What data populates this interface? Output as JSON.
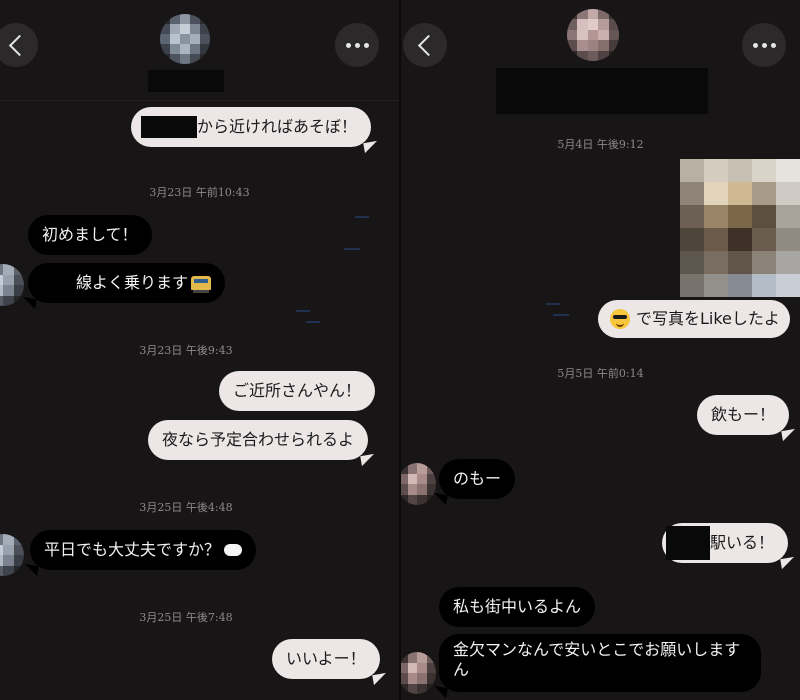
{
  "colors": {
    "background": "#171515",
    "incoming_bubble": "#000000",
    "outgoing_bubble": "#ece6e6",
    "timestamp": "#8d8a8a",
    "button": "#2b2929"
  },
  "left_chat": {
    "header": {
      "back_icon": "chevron-left-icon",
      "more_icon": "more-dots-icon",
      "contact_name": ""
    },
    "messages": [
      {
        "type": "out",
        "text": "から近ければあそぼ！"
      },
      {
        "type": "time",
        "text": "3月23日 午前10:43"
      },
      {
        "type": "in",
        "text": "初めまして！"
      },
      {
        "type": "in",
        "text": "線よく乗ります",
        "icon": "tram-icon"
      },
      {
        "type": "time",
        "text": "3月23日 午後9:43"
      },
      {
        "type": "out",
        "text": "ご近所さんやん！"
      },
      {
        "type": "out",
        "text": "夜なら予定合わせられるよ"
      },
      {
        "type": "time",
        "text": "3月25日 午後4:48"
      },
      {
        "type": "in",
        "text": "平日でも大丈夫ですか？",
        "icon": "thought-balloon-icon"
      },
      {
        "type": "time",
        "text": "3月25日 午後7:48"
      },
      {
        "type": "out",
        "text": "いいよー！"
      }
    ]
  },
  "right_chat": {
    "header": {
      "back_icon": "chevron-left-icon",
      "more_icon": "more-dots-icon",
      "contact_name": ""
    },
    "messages": [
      {
        "type": "time",
        "text": "5月4日 午後9:12"
      },
      {
        "type": "photo",
        "text": ""
      },
      {
        "type": "out",
        "text": "で写真をLikeしたよ",
        "icon": "sunglasses-face-icon"
      },
      {
        "type": "time",
        "text": "5月5日 午前0:14"
      },
      {
        "type": "out",
        "text": "飲もー！"
      },
      {
        "type": "in",
        "text": "のもー"
      },
      {
        "type": "out",
        "text": "駅いる！"
      },
      {
        "type": "in",
        "text": "私も街中いるよん"
      },
      {
        "type": "in",
        "text": "金欠マンなんで安いとこでお願いしますん"
      }
    ]
  }
}
